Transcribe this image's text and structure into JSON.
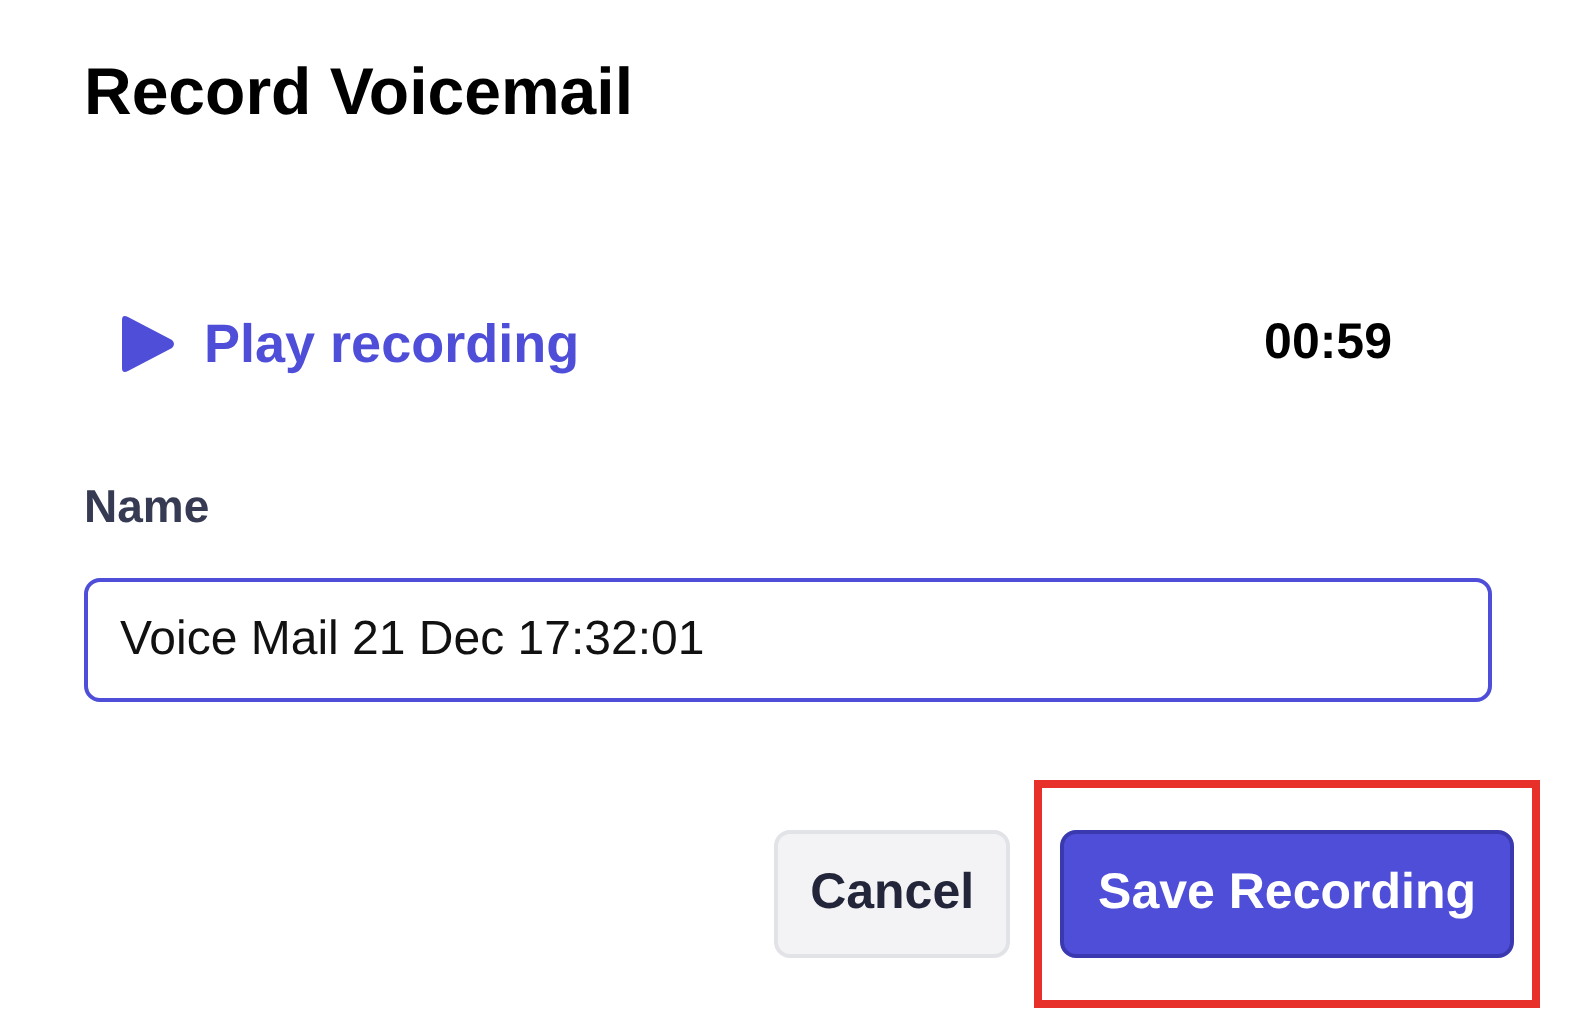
{
  "dialog": {
    "title": "Record Voicemail"
  },
  "player": {
    "label": "Play recording",
    "duration": "00:59"
  },
  "name_field": {
    "label": "Name",
    "value": "Voice Mail 21 Dec 17:32:01"
  },
  "buttons": [
    {
      "label": "Cancel",
      "kind": "secondary",
      "highlighted": false
    },
    {
      "label": "Save Recording",
      "kind": "primary",
      "highlighted": true
    }
  ]
}
